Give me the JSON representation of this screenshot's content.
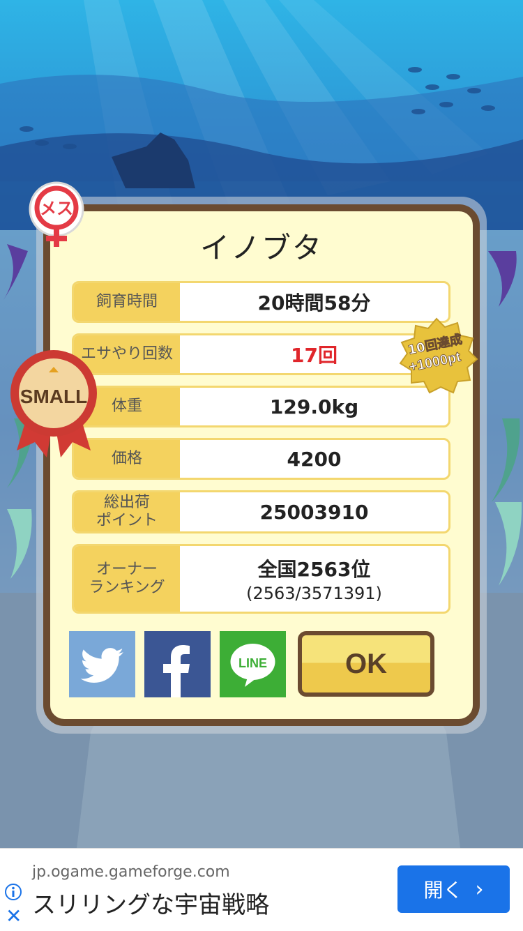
{
  "animal": {
    "name": "イノブタ",
    "gender_label": "メス",
    "size_label": "SMALL"
  },
  "stats": [
    {
      "label": "飼育時間",
      "value": "20時間58分"
    },
    {
      "label": "エサやり回数",
      "value": "17回"
    },
    {
      "label": "体重",
      "value": "129.0kg"
    },
    {
      "label": "価格",
      "value": "4200"
    },
    {
      "label": "総出荷\nポイント",
      "value": "25003910"
    },
    {
      "label": "オーナー\nランキング",
      "value": "全国2563位",
      "sub": "(2563/3571391)"
    }
  ],
  "bonus": {
    "line1": "10回達成",
    "line2": "+1000pt"
  },
  "buttons": {
    "ok": "OK",
    "line": "LINE"
  },
  "icons": [
    "twitter-icon",
    "facebook-icon",
    "line-icon",
    "female-icon",
    "ribbon-icon",
    "info-icon",
    "close-icon",
    "chevron-right-icon"
  ],
  "ad": {
    "url": "jp.ogame.gameforge.com",
    "title": "スリリングな宇宙戦略",
    "button": "開く"
  },
  "colors": {
    "card_bg": "#fffcd0",
    "card_border": "#6b4b30",
    "label_bg": "#f4d25e",
    "highlight": "#e0262b",
    "twitter": "#7aa8d8",
    "facebook": "#3b5694",
    "line": "#3dae36",
    "ad_button": "#1a73e8"
  }
}
